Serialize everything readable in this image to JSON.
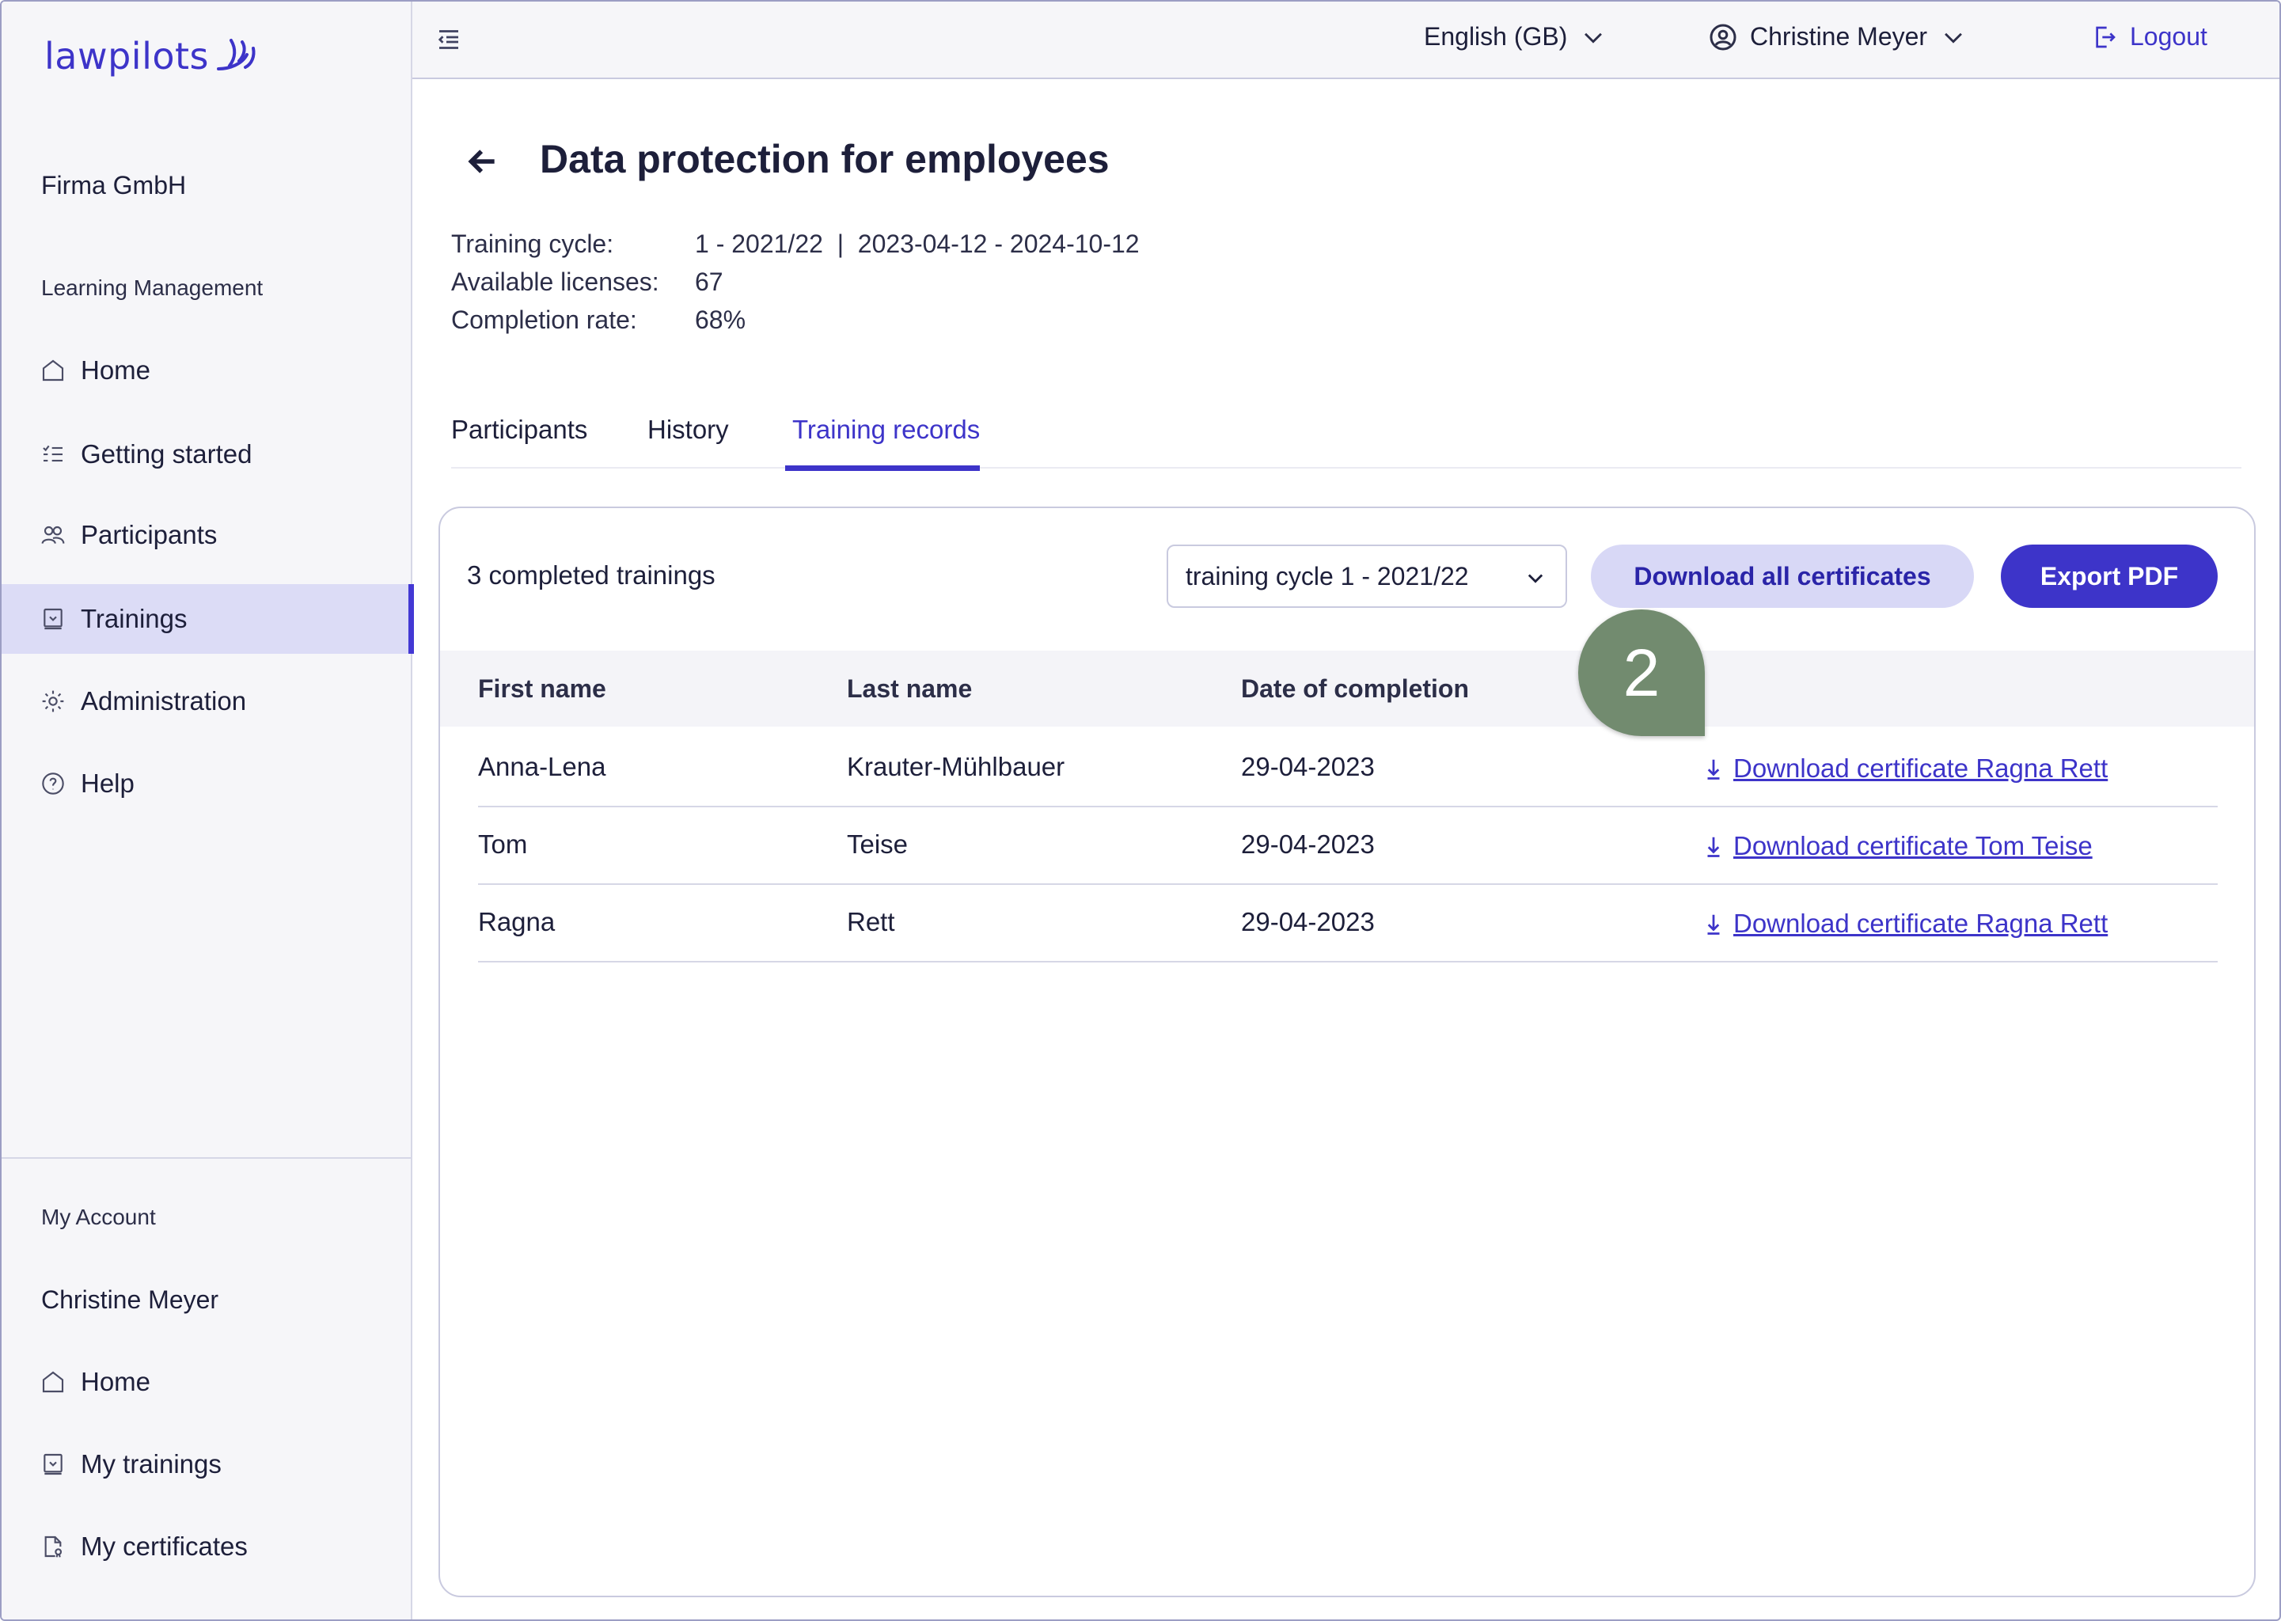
{
  "brand": {
    "logo_text": "lawpilots",
    "accent": "#3d34c9"
  },
  "sidebar": {
    "org_name": "Firma GmbH",
    "section_label": "Learning Management",
    "items": [
      {
        "label": "Home",
        "icon": "home-icon"
      },
      {
        "label": "Getting started",
        "icon": "checklist-icon"
      },
      {
        "label": "Participants",
        "icon": "users-icon"
      },
      {
        "label": "Trainings",
        "icon": "training-icon",
        "active": true
      },
      {
        "label": "Administration",
        "icon": "gear-icon"
      },
      {
        "label": "Help",
        "icon": "help-icon"
      }
    ],
    "account_label": "My Account",
    "account_name": "Christine Meyer",
    "account_items": [
      {
        "label": "Home",
        "icon": "home-icon"
      },
      {
        "label": "My trainings",
        "icon": "training-icon"
      },
      {
        "label": "My certificates",
        "icon": "certificate-icon"
      }
    ]
  },
  "topbar": {
    "language": "English (GB)",
    "user": "Christine Meyer",
    "logout": "Logout"
  },
  "page": {
    "title": "Data protection for employees",
    "meta": [
      {
        "label": "Training cycle:",
        "value": "1 - 2021/22  |  2023-04-12 - 2024-10-12"
      },
      {
        "label": "Available licenses:",
        "value": "67"
      },
      {
        "label": "Completion rate:",
        "value": "68%"
      }
    ],
    "tabs": [
      {
        "label": "Participants"
      },
      {
        "label": "History"
      },
      {
        "label": "Training records",
        "active": true
      }
    ]
  },
  "records": {
    "count_label": "3 completed trainings",
    "cycle_select": "training cycle 1 - 2021/22",
    "download_all": "Download all certificates",
    "export_pdf": "Export PDF",
    "columns": [
      "First name",
      "Last name",
      "Date of completion"
    ],
    "rows": [
      {
        "first": "Anna-Lena",
        "last": "Krauter-Mühlbauer",
        "date": "29-04-2023",
        "link": "Download certificate Ragna Rett"
      },
      {
        "first": "Tom",
        "last": "Teise",
        "date": "29-04-2023",
        "link": "Download certificate Tom Teise"
      },
      {
        "first": "Ragna",
        "last": "Rett",
        "date": "29-04-2023",
        "link": "Download certificate Ragna Rett"
      }
    ]
  },
  "step_marker": {
    "number": "2",
    "color": "#728b6f"
  }
}
